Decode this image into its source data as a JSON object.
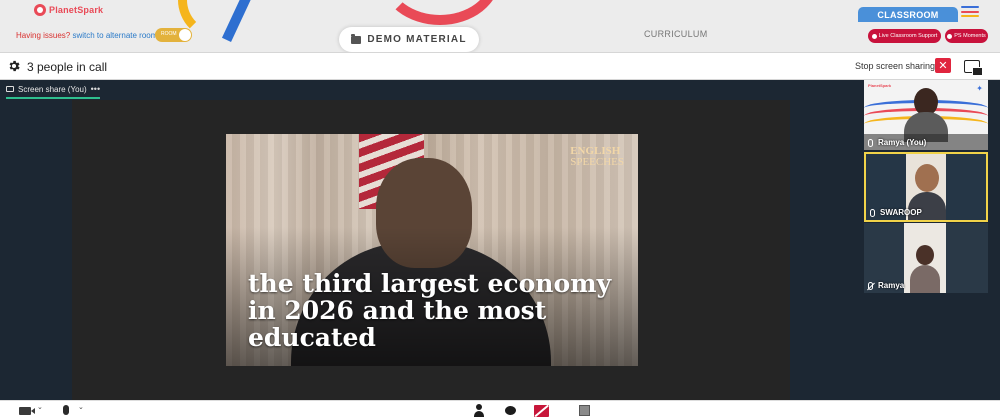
{
  "brand": {
    "logo_text": "PlanetSpark"
  },
  "topbar": {
    "issues_prefix": "Having issues?",
    "issues_link": "switch to alternate room",
    "toggle_label": "ROOM",
    "demo_button": "DEMO MATERIAL",
    "curriculum_tab": "CURRICULUM",
    "classroom_tab": "CLASSROOM",
    "support_button": "Live Classroom Support",
    "moments_button": "PS Moments",
    "colors": {
      "accent_red": "#c8123c",
      "classroom_blue": "#4a90d9",
      "toggle_gold": "#e3b23c"
    }
  },
  "call": {
    "people_count": "3 people in call",
    "stop_sharing": "Stop screen sharing",
    "close_symbol": "✕"
  },
  "stage": {
    "share_tab_label": "Screen share (You)",
    "more_symbol": "•••",
    "video": {
      "brand_line1": "ENGLISH",
      "brand_line2": "SPEECHES",
      "caption": "the third largest economy in 2026 and the most educated"
    }
  },
  "participants": [
    {
      "name": "Ramya (You)",
      "mic": "on",
      "logo": "PlanetSpark"
    },
    {
      "name": "SWAROOP",
      "mic": "on",
      "active_speaker": true
    },
    {
      "name": "Ramya",
      "mic": "off"
    }
  ],
  "toolbar": {
    "icons": [
      "camera-icon",
      "microphone-icon",
      "participants-icon",
      "chat-icon",
      "screen-share-off-icon",
      "whiteboard-icon"
    ]
  }
}
